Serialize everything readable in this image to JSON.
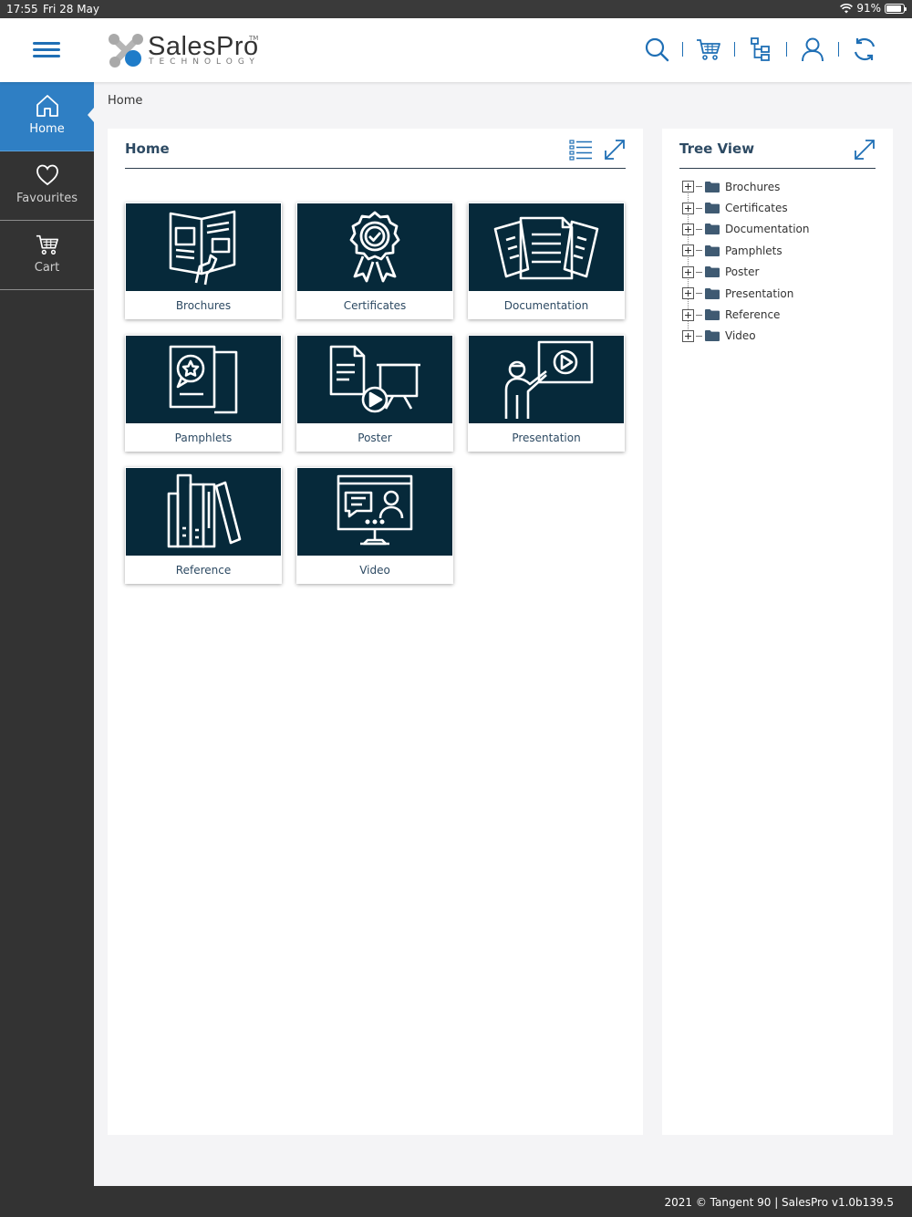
{
  "status_bar": {
    "time": "17:55",
    "date": "Fri 28 May",
    "battery_text": "91%",
    "battery_level": 0.91
  },
  "header": {
    "logo": {
      "brand": "SalesPro",
      "tm": "TM",
      "subtitle": "TECHNOLOGY"
    },
    "icons": [
      "search-icon",
      "cart-icon",
      "tree-structure-icon",
      "user-icon",
      "sync-icon"
    ]
  },
  "sidebar": {
    "items": [
      {
        "label": "Home",
        "icon": "home-icon",
        "active": true
      },
      {
        "label": "Favourites",
        "icon": "heart-icon",
        "active": false
      },
      {
        "label": "Cart",
        "icon": "cart-icon",
        "active": false
      }
    ]
  },
  "breadcrumb": "Home",
  "main_panel": {
    "title": "Home",
    "tiles": [
      {
        "label": "Brochures",
        "icon": "brochure-icon"
      },
      {
        "label": "Certificates",
        "icon": "certificate-icon"
      },
      {
        "label": "Documentation",
        "icon": "documentation-icon"
      },
      {
        "label": "Pamphlets",
        "icon": "pamphlet-icon"
      },
      {
        "label": "Poster",
        "icon": "poster-icon"
      },
      {
        "label": "Presentation",
        "icon": "presentation-icon"
      },
      {
        "label": "Reference",
        "icon": "reference-books-icon"
      },
      {
        "label": "Video",
        "icon": "video-icon"
      }
    ]
  },
  "tree_panel": {
    "title": "Tree View",
    "items": [
      "Brochures",
      "Certificates",
      "Documentation",
      "Pamphlets",
      "Poster",
      "Presentation",
      "Reference",
      "Video"
    ]
  },
  "footer": {
    "text": "2021 © Tangent 90 | SalesPro v1.0b139.5"
  },
  "colors": {
    "accent": "#2f7fc4",
    "tile_bg": "#06293a",
    "sidebar_bg": "#333333",
    "title_text": "#2d4a63"
  }
}
